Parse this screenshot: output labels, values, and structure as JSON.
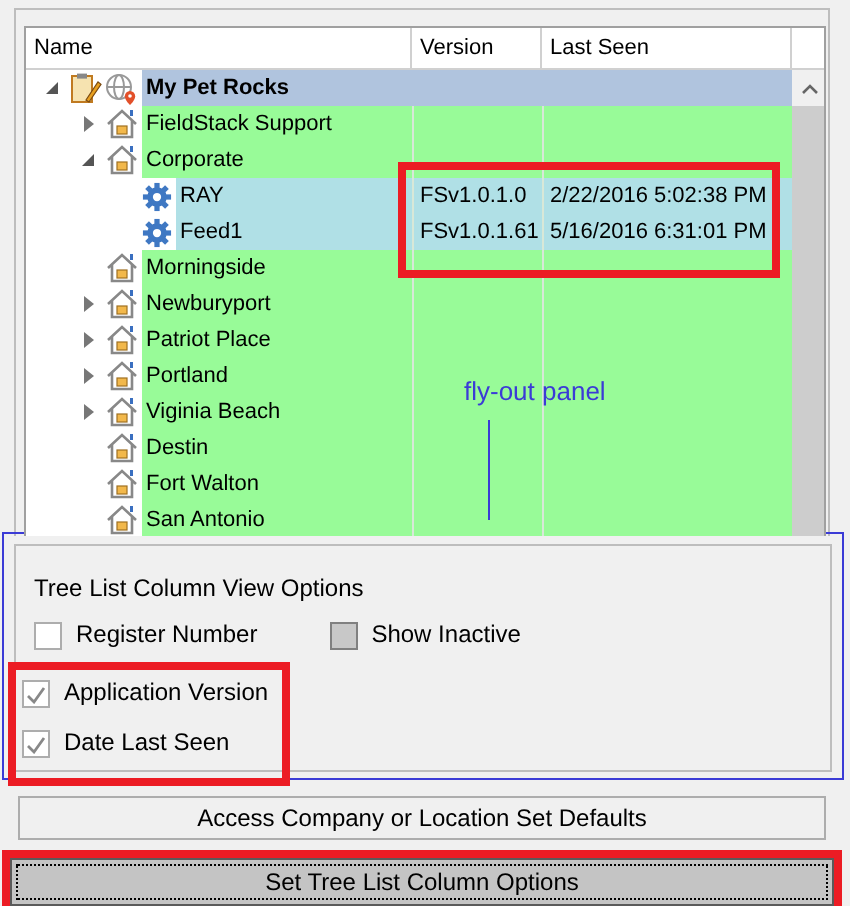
{
  "tree": {
    "columns": [
      "Name",
      "Version",
      "Last Seen"
    ],
    "highlight_values": true,
    "rows": [
      {
        "kind": "root",
        "label": "My Pet Rocks",
        "selected": true,
        "expanded": true,
        "children": [
          {
            "kind": "location",
            "label": "FieldStack Support",
            "selected": false,
            "expanded": false
          },
          {
            "kind": "location",
            "label": "Corporate",
            "selected": false,
            "expanded": true,
            "children": [
              {
                "kind": "device",
                "label": "RAY",
                "selected": false,
                "version": "FSv1.0.1.0",
                "last_seen": "2/22/2016 5:02:38 PM"
              },
              {
                "kind": "device",
                "label": "Feed1",
                "selected": false,
                "version": "FSv1.0.1.61",
                "last_seen": "5/16/2016 6:31:01 PM"
              }
            ]
          },
          {
            "kind": "location",
            "label": "Morningside",
            "selected": false
          },
          {
            "kind": "location",
            "label": "Newburyport",
            "selected": false,
            "expanded": false
          },
          {
            "kind": "location",
            "label": "Patriot Place",
            "selected": false,
            "expanded": false
          },
          {
            "kind": "location",
            "label": "Portland",
            "selected": false,
            "expanded": false
          },
          {
            "kind": "location",
            "label": "Viginia Beach",
            "selected": false,
            "expanded": false
          },
          {
            "kind": "location",
            "label": "Destin",
            "selected": false
          },
          {
            "kind": "location",
            "label": "Fort Walton",
            "selected": false
          },
          {
            "kind": "location",
            "label": "San Antonio",
            "selected": false
          }
        ]
      }
    ]
  },
  "callout": {
    "label": "fly-out panel"
  },
  "options": {
    "title": "Tree List Column View Options",
    "checkboxes": [
      {
        "label": "Register Number",
        "checked": false,
        "disabled": false,
        "highlighted": false
      },
      {
        "label": "Show Inactive",
        "checked": false,
        "disabled": true,
        "highlighted": false
      },
      {
        "label": "Application Version",
        "checked": true,
        "disabled": false,
        "highlighted": true
      },
      {
        "label": "Date Last Seen",
        "checked": true,
        "disabled": false,
        "highlighted": true
      }
    ]
  },
  "buttons": [
    {
      "label": "Access Company or Location Set Defaults",
      "highlighted": false,
      "focused": false
    },
    {
      "label": "Set Tree List Column Options",
      "highlighted": true,
      "focused": true
    }
  ]
}
